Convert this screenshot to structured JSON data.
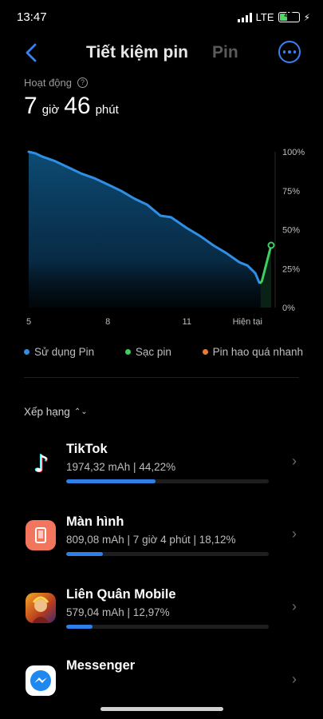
{
  "status_bar": {
    "time": "13:47",
    "network": "LTE",
    "battery_level": "43"
  },
  "header": {
    "title": "Tiết kiệm pin",
    "second_tab": "Pin",
    "back_icon": "chevron-left-icon",
    "more_icon": "more-horizontal-icon"
  },
  "activity": {
    "label": "Hoạt động",
    "hours": "7",
    "hours_unit": "giờ",
    "minutes": "46",
    "minutes_unit": "phút"
  },
  "chart_data": {
    "type": "line",
    "x_tick_labels": [
      "5",
      "8",
      "11",
      "Hiện tại"
    ],
    "y_tick_labels": [
      "100%",
      "75%",
      "50%",
      "25%",
      "0%"
    ],
    "ylim": [
      0,
      100
    ],
    "series": [
      {
        "name": "Sử dụng Pin",
        "color": "#2f8fe6",
        "points": [
          [
            5.0,
            100
          ],
          [
            5.25,
            99
          ],
          [
            5.5,
            97
          ],
          [
            6.0,
            94
          ],
          [
            6.5,
            90
          ],
          [
            7.0,
            86
          ],
          [
            7.5,
            83
          ],
          [
            8.0,
            79
          ],
          [
            8.5,
            75
          ],
          [
            9.0,
            70
          ],
          [
            9.5,
            66
          ],
          [
            10.0,
            59
          ],
          [
            10.4,
            58
          ],
          [
            11.0,
            51
          ],
          [
            11.5,
            46
          ],
          [
            12.0,
            40
          ],
          [
            12.5,
            35
          ],
          [
            13.0,
            29
          ],
          [
            13.3,
            27
          ],
          [
            13.6,
            22
          ],
          [
            13.75,
            16
          ],
          [
            13.8,
            16
          ]
        ]
      },
      {
        "name": "Sạc pin",
        "color": "#3ecf5c",
        "points": [
          [
            13.8,
            16
          ],
          [
            13.85,
            17
          ],
          [
            14.2,
            40
          ]
        ]
      }
    ],
    "legend": [
      {
        "label": "Sử dụng Pin",
        "color": "#2f8fe6"
      },
      {
        "label": "Sạc pin",
        "color": "#3ecf5c"
      },
      {
        "label": "Pin hao quá nhanh",
        "color": "#f07a2c"
      }
    ],
    "grid": false
  },
  "ranking": {
    "label": "Xếp hạng"
  },
  "apps": [
    {
      "name": "TikTok",
      "detail": "1974,32 mAh | 44,22%",
      "percent": 44.22,
      "icon": "tiktok-app-icon"
    },
    {
      "name": "Màn hình",
      "detail": "809,08 mAh | 7 giờ 4 phút  | 18,12%",
      "percent": 18.12,
      "icon": "screen-icon"
    },
    {
      "name": "Liên Quân Mobile",
      "detail": "579,04 mAh | 12,97%",
      "percent": 12.97,
      "icon": "lien-quan-app-icon"
    },
    {
      "name": "Messenger",
      "detail": "",
      "percent": 0,
      "icon": "messenger-app-icon"
    }
  ]
}
